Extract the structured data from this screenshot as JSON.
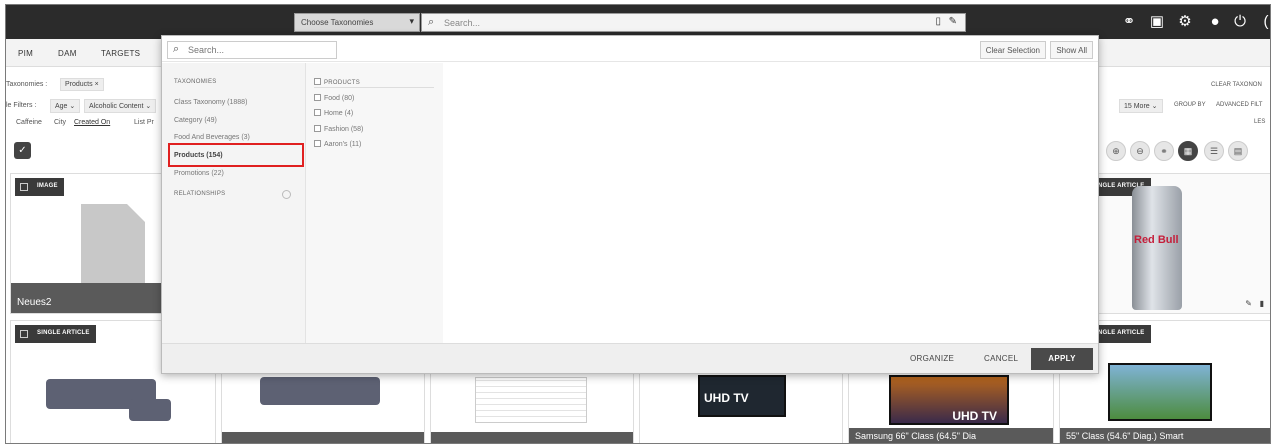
{
  "topbar": {
    "taxonomy_select": "Choose Taxonomies",
    "search_placeholder": "Search..."
  },
  "nav": {
    "tabs": [
      "PIM",
      "DAM",
      "TARGETS"
    ]
  },
  "filters": {
    "taxonomies_label": "Taxonomies :",
    "taxonomies_chip": "Products",
    "filters_label": "le Filters :",
    "filter_age": "Age",
    "filter_alcohol": "Alcoholic Content",
    "row3": [
      "Caffeine",
      "City",
      "Created On",
      "List Pr"
    ],
    "clear_taxonomy": "CLEAR TAXONON",
    "more": "15 More",
    "group_by": "GROUP BY",
    "advanced": "ADVANCED FILT",
    "les": "LES"
  },
  "cards": {
    "c1_tag": "IMAGE",
    "c1_title": "Neues2",
    "c2_tag": "SINGLE ARTICLE",
    "c3_tag": "SINGLE ARTICLE",
    "c4_tag": "NGLE ARTICLE",
    "c5_tag": "NGLE ARTICLE",
    "tv1_label": "UHD TV",
    "tv2_label": "UHD TV",
    "tv2_title": "Samsung 66\" Class (64.5\" Dia",
    "tv3_title": "55\" Class (54.6\" Diag.) Smart",
    "can_label": "Red Bull"
  },
  "overlay": {
    "search_placeholder": "Search...",
    "clear_selection": "Clear Selection",
    "show_all": "Show All",
    "taxonomies_header": "TAXONOMIES",
    "taxonomies": [
      "Class Taxonomy (1888)",
      "Category (49)",
      "Food And Beverages (3)",
      "Products (154)",
      "Promotions (22)"
    ],
    "relationships_header": "RELATIONSHIPS",
    "products_header": "PRODUCTS",
    "products": [
      "Food (80)",
      "Home (4)",
      "Fashion (58)",
      "Aaron's (11)"
    ],
    "footer": {
      "organize": "ORGANIZE",
      "cancel": "CANCEL",
      "apply": "APPLY"
    }
  }
}
